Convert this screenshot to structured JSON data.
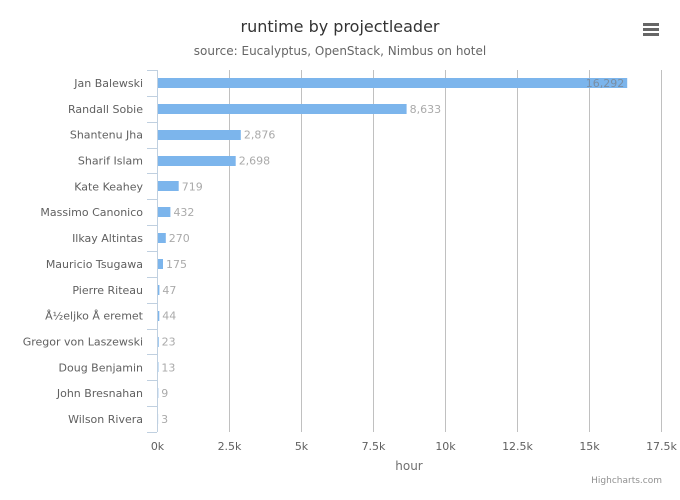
{
  "chart_data": {
    "type": "bar",
    "orientation": "horizontal",
    "title": "runtime by projectleader",
    "subtitle": "source: Eucalyptus, OpenStack, Nimbus on hotel",
    "xlabel": "hour",
    "ylabel": "",
    "categories": [
      "Jan Balewski",
      "Randall Sobie",
      "Shantenu Jha",
      "Sharif Islam",
      "Kate Keahey",
      "Massimo Canonico",
      "Ilkay Altintas",
      "Mauricio Tsugawa",
      "Pierre Riteau",
      "Å½eljko Å eremet",
      "Gregor von Laszewski",
      "Doug Benjamin",
      "John Bresnahan",
      "Wilson Rivera"
    ],
    "values": [
      16292,
      8633,
      2876,
      2698,
      719,
      432,
      270,
      175,
      47,
      44,
      23,
      13,
      9,
      3
    ],
    "data_labels": [
      "16,292",
      "8,633",
      "2,876",
      "2,698",
      "719",
      "432",
      "270",
      "175",
      "47",
      "44",
      "23",
      "13",
      "9",
      "3"
    ],
    "xlim": [
      0,
      17500
    ],
    "ticks": [
      0,
      2500,
      5000,
      7500,
      10000,
      12500,
      15000,
      17500
    ],
    "tick_labels": [
      "0k",
      "2.5k",
      "5k",
      "7.5k",
      "10k",
      "12.5k",
      "15k",
      "17.5k"
    ],
    "grid": true,
    "legend": "none",
    "series_color": "#7cb5ec"
  },
  "menu": {
    "icon": "hamburger-menu-icon"
  },
  "credits": "Highcharts.com"
}
